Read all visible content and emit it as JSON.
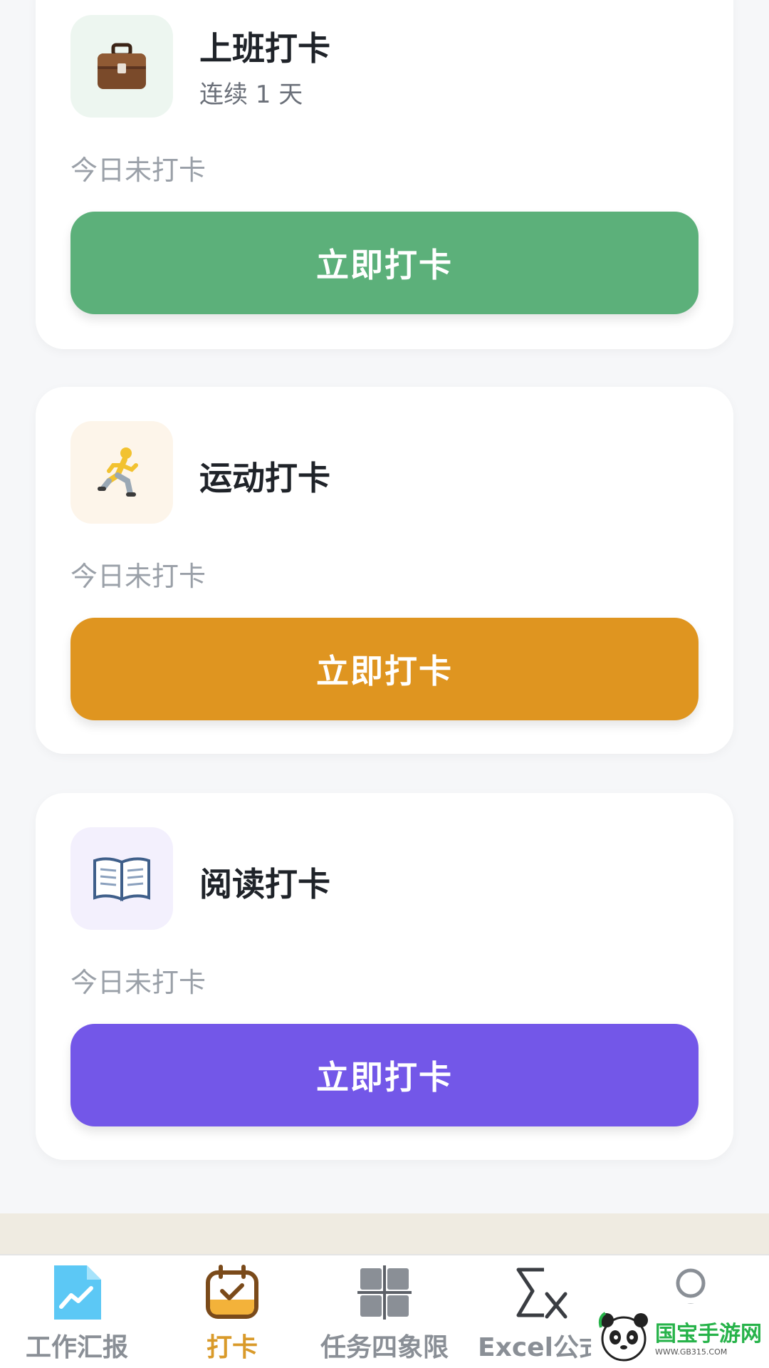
{
  "cards": [
    {
      "icon": "briefcase-icon",
      "icon_bg": "#edf6f0",
      "title": "上班打卡",
      "subtitle": "连续 1 天",
      "status": "今日未打卡",
      "button_label": "立即打卡",
      "button_color": "#5cb07a"
    },
    {
      "icon": "runner-icon",
      "icon_bg": "#fdf5ea",
      "title": "运动打卡",
      "subtitle": "",
      "status": "今日未打卡",
      "button_label": "立即打卡",
      "button_color": "#df9520"
    },
    {
      "icon": "book-icon",
      "icon_bg": "#f3f0fd",
      "title": "阅读打卡",
      "subtitle": "",
      "status": "今日未打卡",
      "button_label": "立即打卡",
      "button_color": "#7357e8"
    }
  ],
  "tabbar": {
    "items": [
      {
        "label": "工作汇报",
        "icon": "chart-document-icon",
        "active": false
      },
      {
        "label": "打卡",
        "icon": "calendar-check-icon",
        "active": true
      },
      {
        "label": "任务四象限",
        "icon": "quadrant-grid-icon",
        "active": false
      },
      {
        "label": "Excel公式",
        "icon": "sigma-x-icon",
        "active": false
      },
      {
        "label": "",
        "icon": "user-icon",
        "active": false
      }
    ],
    "active_color": "#d99a2a",
    "inactive_color": "#8a8f96"
  },
  "watermark": {
    "title": "国宝手游网",
    "url": "WWW.GB315.COM"
  }
}
